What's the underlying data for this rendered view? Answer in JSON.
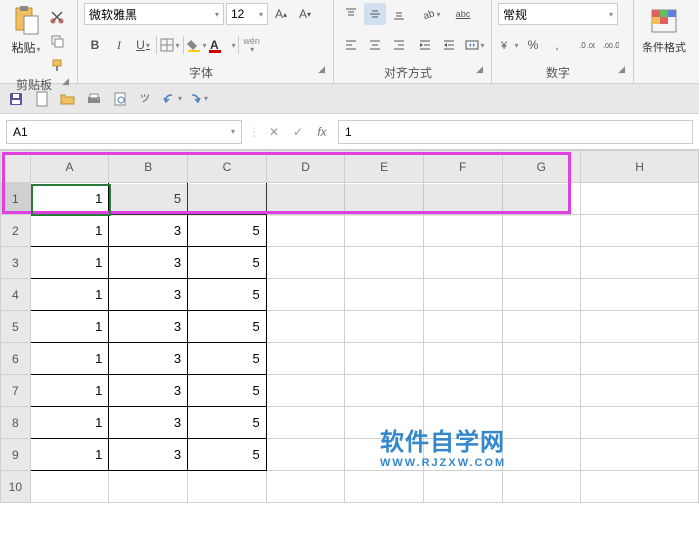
{
  "ribbon": {
    "clipboard": {
      "paste": "粘贴",
      "label": "剪贴板"
    },
    "font": {
      "name": "微软雅黑",
      "size": "12",
      "bold": "B",
      "italic": "I",
      "underline": "U",
      "pinyin": "wén",
      "label": "字体"
    },
    "align": {
      "wrap": "abc",
      "label": "对齐方式"
    },
    "number": {
      "format": "常规",
      "pct": "%",
      "comma": ",",
      "label": "数字"
    },
    "styles": {
      "condfmt": "条件格式"
    }
  },
  "qat": {},
  "fbar": {
    "namebox": "A1",
    "fx": "fx",
    "value": "1"
  },
  "grid": {
    "cols": [
      "A",
      "B",
      "C",
      "D",
      "E",
      "F",
      "G",
      "H"
    ],
    "rows": [
      "1",
      "2",
      "3",
      "4",
      "5",
      "6",
      "7",
      "8",
      "9",
      "10"
    ],
    "data": {
      "1": {
        "A": "1",
        "B": "5"
      },
      "2": {
        "A": "1",
        "B": "3",
        "C": "5"
      },
      "3": {
        "A": "1",
        "B": "3",
        "C": "5"
      },
      "4": {
        "A": "1",
        "B": "3",
        "C": "5"
      },
      "5": {
        "A": "1",
        "B": "3",
        "C": "5"
      },
      "6": {
        "A": "1",
        "B": "3",
        "C": "5"
      },
      "7": {
        "A": "1",
        "B": "3",
        "C": "5"
      },
      "8": {
        "A": "1",
        "B": "3",
        "C": "5"
      },
      "9": {
        "A": "1",
        "B": "3",
        "C": "5"
      }
    }
  },
  "watermark": {
    "main": "软件自学网",
    "sub": "WWW.RJZXW.COM"
  }
}
